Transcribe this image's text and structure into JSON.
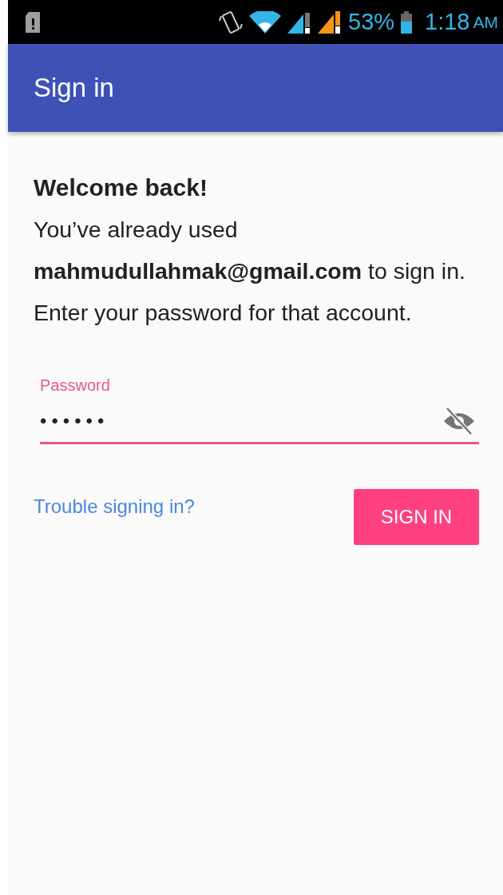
{
  "status_bar": {
    "battery": "53%",
    "time": "1:18",
    "meridiem": "AM"
  },
  "app_bar": {
    "title": "Sign in"
  },
  "heading": "Welcome back!",
  "message": "You’ve already used **mahmudullahmak@gmail.com** to sign in. Enter your password for that account.",
  "password": {
    "label": "Password",
    "value": "••••••",
    "focused": true
  },
  "trouble_link": "Trouble signing in?",
  "sign_in_button": "SIGN IN"
}
